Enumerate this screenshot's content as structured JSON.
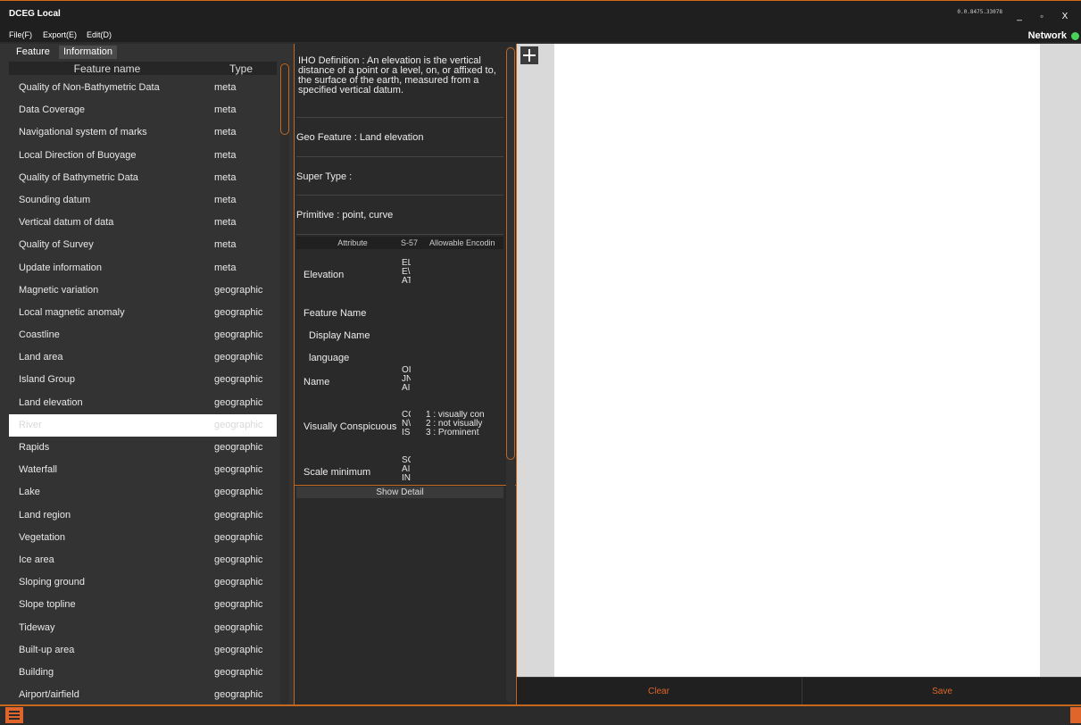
{
  "window": {
    "title": "DCEG Local",
    "version": "0.0.8475.33078",
    "min_label": "_",
    "max_label": "▫",
    "close_label": "X"
  },
  "menu": {
    "file": "File(F)",
    "export": "Export(E)",
    "edit": "Edit(D)",
    "network_label": "Network",
    "network_status_color": "#4ad15a"
  },
  "left": {
    "tabs": [
      "Feature",
      "Information"
    ],
    "active_tab": "Information",
    "headers": {
      "name": "Feature name",
      "type": "Type"
    },
    "selected_index": 15,
    "features": [
      {
        "name": "Quality of Non-Bathymetric Data",
        "type": "meta"
      },
      {
        "name": "Data Coverage",
        "type": "meta"
      },
      {
        "name": "Navigational system of marks",
        "type": "meta"
      },
      {
        "name": "Local Direction of Buoyage",
        "type": "meta"
      },
      {
        "name": "Quality of Bathymetric Data",
        "type": "meta"
      },
      {
        "name": "Sounding datum",
        "type": "meta"
      },
      {
        "name": "Vertical datum of data",
        "type": "meta"
      },
      {
        "name": "Quality of Survey",
        "type": "meta"
      },
      {
        "name": "Update information",
        "type": "meta"
      },
      {
        "name": "Magnetic variation",
        "type": "geographic"
      },
      {
        "name": "Local magnetic anomaly",
        "type": "geographic"
      },
      {
        "name": "Coastline",
        "type": "geographic"
      },
      {
        "name": "Land area",
        "type": "geographic"
      },
      {
        "name": "Island Group",
        "type": "geographic"
      },
      {
        "name": "Land elevation",
        "type": "geographic"
      },
      {
        "name": "River",
        "type": "geographic"
      },
      {
        "name": "Rapids",
        "type": "geographic"
      },
      {
        "name": "Waterfall",
        "type": "geographic"
      },
      {
        "name": "Lake",
        "type": "geographic"
      },
      {
        "name": "Land region",
        "type": "geographic"
      },
      {
        "name": "Vegetation",
        "type": "geographic"
      },
      {
        "name": "Ice area",
        "type": "geographic"
      },
      {
        "name": "Sloping ground",
        "type": "geographic"
      },
      {
        "name": "Slope topline",
        "type": "geographic"
      },
      {
        "name": "Tideway",
        "type": "geographic"
      },
      {
        "name": "Built-up area",
        "type": "geographic"
      },
      {
        "name": "Building",
        "type": "geographic"
      },
      {
        "name": "Airport/airfield",
        "type": "geographic"
      }
    ]
  },
  "info": {
    "definition": "IHO Definition : An elevation is the vertical distance of a point or a level, on, or affixed to, the surface of the earth, measured from a specified vertical datum.",
    "geo_feature": "Geo Feature : Land elevation",
    "super_type": "Super Type :",
    "primitive": "Primitive : point, curve",
    "attr_headers": {
      "attribute": "Attribute",
      "s57": "S-57",
      "encoding": "Allowable Encodin"
    },
    "attributes": [
      {
        "name": "Elevation",
        "code": "EL\nE\\\nAT",
        "encoding": ""
      },
      {
        "name": "Feature Name",
        "code": "",
        "encoding": ""
      },
      {
        "name": "Display Name",
        "code": "",
        "encoding": ""
      },
      {
        "name": "language",
        "code": "",
        "encoding": ""
      },
      {
        "name": "Name",
        "code": "OI\nJN\nAI",
        "encoding": ""
      },
      {
        "name": "Visually Conspicuous",
        "code": "CC\nN\\\nIS",
        "encoding": "1 : visually con\n2 : not visually\n3 : Prominent"
      },
      {
        "name": "Scale minimum",
        "code": "SC\nAI\nIN",
        "encoding": ""
      }
    ],
    "show_detail": "Show Detail"
  },
  "actions": {
    "clear": "Clear",
    "save": "Save"
  },
  "colors": {
    "accent": "#e0652a",
    "border": "#c4671f",
    "selected_row": "#ffffff",
    "network_ok": "#4ad15a"
  }
}
